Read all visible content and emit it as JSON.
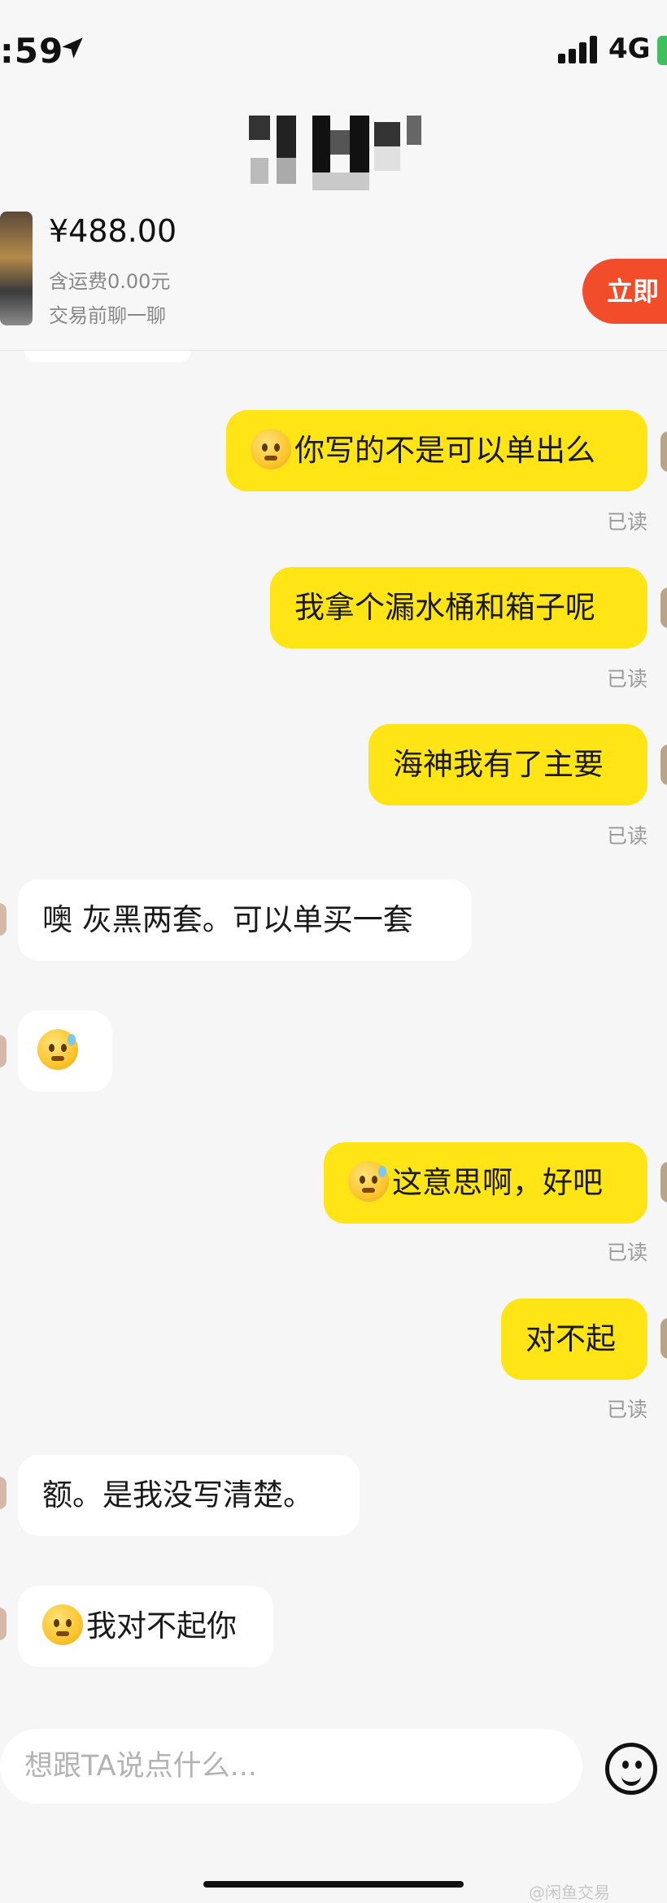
{
  "status_bar": {
    "time": ":59",
    "network": "4G"
  },
  "product": {
    "price": "¥488.00",
    "shipping": "含运费0.00元",
    "chat_hint": "交易前聊一聊",
    "buy_label": "立即"
  },
  "messages": [
    {
      "side": "me",
      "text": "你写的不是可以单出么",
      "emoji": true,
      "read": "已读"
    },
    {
      "side": "me",
      "text": "我拿个漏水桶和箱子呢",
      "emoji": false,
      "read": "已读"
    },
    {
      "side": "me",
      "text": "海神我有了主要",
      "emoji": false,
      "read": "已读"
    },
    {
      "side": "them",
      "text": "噢 灰黑两套。可以单买一套",
      "emoji": false
    },
    {
      "side": "them",
      "text": "",
      "emoji": true
    },
    {
      "side": "me",
      "text": "这意思啊，好吧",
      "emoji": true,
      "read": "已读"
    },
    {
      "side": "me",
      "text": "对不起",
      "emoji": false,
      "read": "已读"
    },
    {
      "side": "them",
      "text": "额。是我没写清楚。",
      "emoji": false
    },
    {
      "side": "them",
      "text": "我对不起你",
      "emoji": true
    }
  ],
  "input": {
    "placeholder": "想跟TA说点什么..."
  },
  "watermark": "@闲鱼交易"
}
